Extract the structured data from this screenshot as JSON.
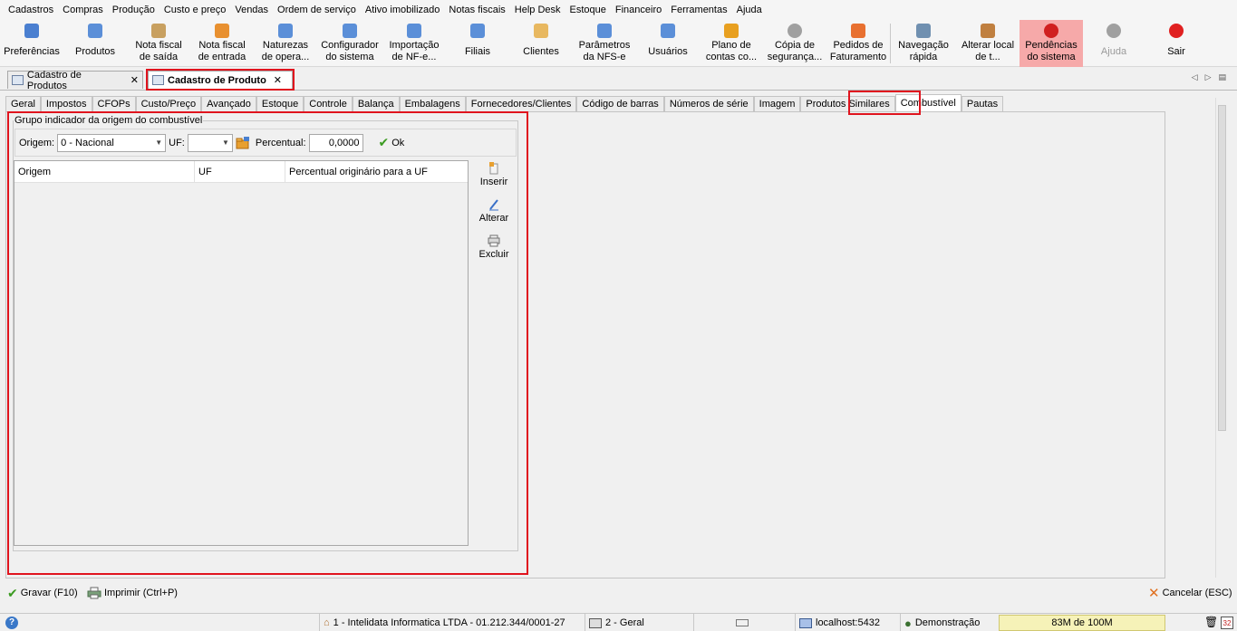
{
  "menu": [
    "Cadastros",
    "Compras",
    "Produção",
    "Custo e preço",
    "Vendas",
    "Ordem de serviço",
    "Ativo imobilizado",
    "Notas fiscais",
    "Help Desk",
    "Estoque",
    "Financeiro",
    "Ferramentas",
    "Ajuda"
  ],
  "toolbar": [
    {
      "label": "Preferências",
      "icon": "preferences-icon",
      "color": "#4a7fd0"
    },
    {
      "label": "Produtos",
      "icon": "products-icon",
      "color": "#5b8fd8"
    },
    {
      "label": "Nota fiscal\nde saída",
      "icon": "invoice-out-icon",
      "color": "#c8a060"
    },
    {
      "label": "Nota fiscal\nde entrada",
      "icon": "invoice-in-icon",
      "color": "#e89030"
    },
    {
      "label": "Naturezas\nde opera...",
      "icon": "operations-icon",
      "color": "#5b8fd8"
    },
    {
      "label": "Configurador\ndo sistema",
      "icon": "config-icon",
      "color": "#5b8fd8"
    },
    {
      "label": "Importação\nde NF-e...",
      "icon": "import-icon",
      "color": "#5b8fd8"
    },
    {
      "label": "Filiais",
      "icon": "branches-icon",
      "color": "#5b8fd8"
    },
    {
      "label": "Clientes",
      "icon": "clients-icon",
      "color": "#e8b860"
    },
    {
      "label": "Parâmetros\nda NFS-e",
      "icon": "nfse-params-icon",
      "color": "#5b8fd8"
    },
    {
      "label": "Usuários",
      "icon": "users-icon",
      "color": "#5b8fd8"
    },
    {
      "label": "Plano de\ncontas co...",
      "icon": "accounts-plan-icon",
      "color": "#e8a020"
    },
    {
      "label": "Cópia de\nsegurança...",
      "icon": "backup-icon",
      "color": "#a0a0a0"
    },
    {
      "label": "Pedidos de\nFaturamento",
      "icon": "billing-orders-icon",
      "color": "#e87030"
    },
    {
      "label": "Navegação\nrápida",
      "icon": "quick-nav-icon",
      "color": "#7090b0"
    },
    {
      "label": "Alterar local\nde t...",
      "icon": "home-icon",
      "color": "#c08040"
    },
    {
      "label": "Pendências\ndo sistema",
      "icon": "alert-icon",
      "color": "#d02020"
    },
    {
      "label": "Ajuda",
      "icon": "help-icon",
      "color": "#a0a0a0"
    },
    {
      "label": "Sair",
      "icon": "power-icon",
      "color": "#e02020"
    }
  ],
  "doctabs": [
    {
      "label": "Cadastro de Produtos",
      "close": "✕"
    },
    {
      "label": "Cadastro de Produto",
      "close": "✕"
    }
  ],
  "nav": {
    "prev": "◁",
    "next": "▷",
    "list": "▤"
  },
  "innertabs": [
    "Geral",
    "Impostos",
    "CFOPs",
    "Custo/Preço",
    "Avançado",
    "Estoque",
    "Controle",
    "Balança",
    "Embalagens",
    "Fornecedores/Clientes",
    "Código de barras",
    "Números de série",
    "Imagem",
    "Produtos Similares",
    "Combustível",
    "Pautas"
  ],
  "group": {
    "title": "Grupo indicador da origem do combustível",
    "origem_label": "Origem:",
    "origem_value": "0 - Nacional",
    "uf_label": "UF:",
    "uf_value": "",
    "percentual_label": "Percentual:",
    "percentual_value": "0,0000",
    "ok_label": "Ok"
  },
  "grid": {
    "columns": [
      "Origem",
      "UF",
      "Percentual originário para a UF"
    ],
    "rows": []
  },
  "side_buttons": [
    {
      "label": "Inserir",
      "icon": "insert-icon"
    },
    {
      "label": "Alterar",
      "icon": "edit-icon"
    },
    {
      "label": "Excluir",
      "icon": "delete-icon"
    }
  ],
  "actions": {
    "save": "Gravar (F10)",
    "print": "Imprimir (Ctrl+P)",
    "cancel": "Cancelar (ESC)"
  },
  "status": {
    "company": "1 - Intelidata Informatica LTDA - 01.212.344/0001-27",
    "department": "2 - Geral",
    "server": "localhost:5432",
    "user": "Demonstração",
    "memory": "83M de 100M",
    "counter": "32"
  }
}
